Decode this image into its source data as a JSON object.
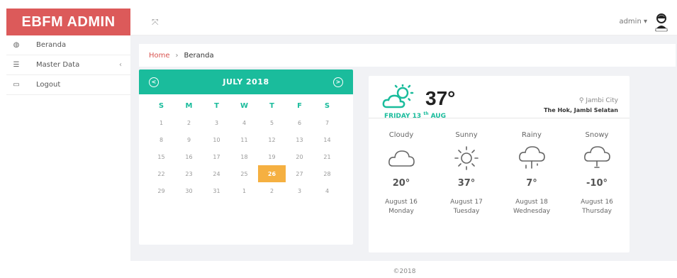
{
  "brand": {
    "title": "EBFM ADMIN"
  },
  "sidebar": {
    "items": [
      {
        "label": "Beranda",
        "icon": "dashboard-icon"
      },
      {
        "label": "Master Data",
        "icon": "list-icon"
      },
      {
        "label": "Logout",
        "icon": "logout-icon"
      }
    ]
  },
  "topbar": {
    "user": "admin"
  },
  "breadcrumb": {
    "home": "Home",
    "separator": "›",
    "current": "Beranda"
  },
  "calendar": {
    "title": "JULY 2018",
    "days_of_week": [
      "S",
      "M",
      "T",
      "W",
      "T",
      "F",
      "S"
    ],
    "weeks": [
      [
        "1",
        "2",
        "3",
        "4",
        "5",
        "6",
        "7"
      ],
      [
        "8",
        "9",
        "10",
        "11",
        "12",
        "13",
        "14"
      ],
      [
        "15",
        "16",
        "17",
        "18",
        "19",
        "20",
        "21"
      ],
      [
        "22",
        "23",
        "24",
        "25",
        "26",
        "27",
        "28"
      ],
      [
        "29",
        "30",
        "31",
        "1",
        "2",
        "3",
        "4"
      ]
    ],
    "selected": "26"
  },
  "weather": {
    "current_temp": "37°",
    "date_day": "FRIDAY 13",
    "date_sup": "th",
    "date_month": "AUG",
    "city": "Jambi City",
    "place": "The Hok, Jambi Selatan",
    "forecast": [
      {
        "condition": "Cloudy",
        "temp": "20°",
        "date": "August 16",
        "day": "Monday"
      },
      {
        "condition": "Sunny",
        "temp": "37°",
        "date": "August 17",
        "day": "Tuesday"
      },
      {
        "condition": "Rainy",
        "temp": "7°",
        "date": "August 18",
        "day": "Wednesday"
      },
      {
        "condition": "Snowy",
        "temp": "-10°",
        "date": "August 16",
        "day": "Thursday"
      }
    ]
  },
  "footer": {
    "text": "©2018"
  },
  "colors": {
    "brand": "#dc5a5a",
    "accent": "#1abc9c",
    "highlight": "#f5b041"
  }
}
